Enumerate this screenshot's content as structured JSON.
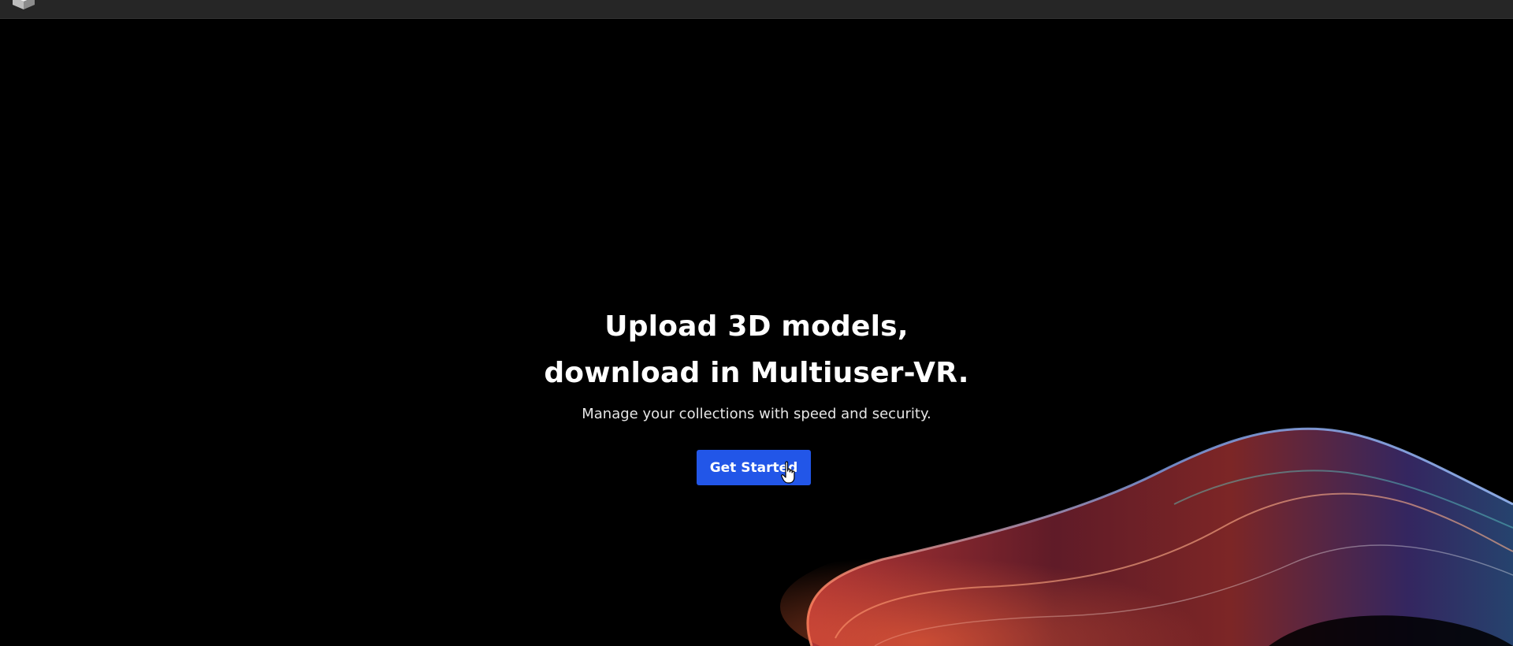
{
  "header": {
    "logo_icon": "cube-logo-icon"
  },
  "hero": {
    "headline_line1": "Upload 3D models,",
    "headline_line2": "download in Multiuser-VR.",
    "subtitle": "Manage your collections with speed and security.",
    "cta_label": "Get Started"
  },
  "colors": {
    "background": "#000000",
    "topbar": "#262626",
    "accent": "#2256e8",
    "text": "#ffffff"
  },
  "decor": {
    "background_graphic": "iridescent-wave-graphic",
    "pointer": "hand-pointer-cursor-icon"
  }
}
